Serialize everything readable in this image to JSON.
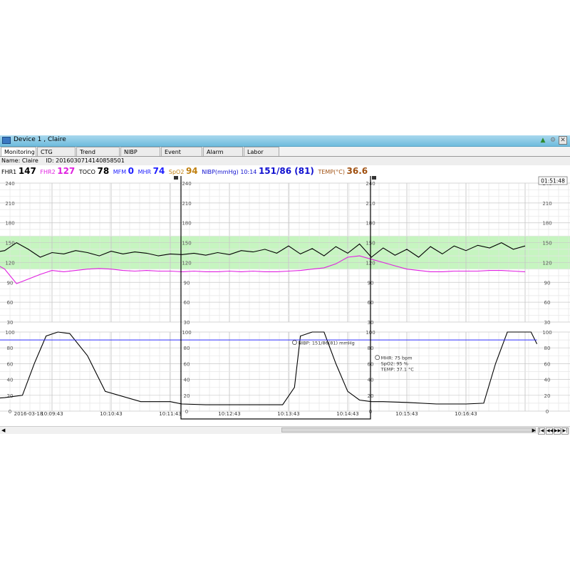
{
  "window": {
    "title": "Device 1 , Claire",
    "icons": [
      "monitor-icon",
      "bell-icon",
      "settings-icon",
      "close-icon"
    ]
  },
  "tabs": [
    {
      "label": "Monitoring",
      "active": true
    },
    {
      "label": "CTG Review",
      "active": false
    },
    {
      "label": "Trend Review",
      "active": false
    },
    {
      "label": "NIBP Review",
      "active": false
    },
    {
      "label": "Event Review",
      "active": false
    },
    {
      "label": "Alarm Setup",
      "active": false
    },
    {
      "label": "Labor Info.",
      "active": false
    }
  ],
  "patient": {
    "name_text": "Name: Claire",
    "id_text": "ID: 201603071414085850​1"
  },
  "vitals": {
    "fhr1_label": "FHR1",
    "fhr1_value": "147",
    "fhr2_label": "FHR2",
    "fhr2_value": "127",
    "toco_label": "TOCO",
    "toco_value": "78",
    "mfm_label": "MFM",
    "mfm_value": "0",
    "mhr_label": "MHR",
    "mhr_value": "74",
    "spo2_label": "SpO2",
    "spo2_value": "94",
    "nibp_label": "NIBP(mmHg) 10:14",
    "nibp_value": "151/86 (81)",
    "temp_label": "TEMP(°C)",
    "temp_value": "36.6"
  },
  "colors": {
    "fhr1": "#000000",
    "fhr2": "#e020e0",
    "toco": "#000000",
    "mfm": "#2020ff",
    "mhr": "#2020ff",
    "spo2": "#c08010",
    "nibp": "#1010d0",
    "temp": "#a05010",
    "normal_band": "#c6f5c0",
    "grid": "#c8c8c8",
    "maternal_trace": "#3030ff"
  },
  "clock": "01:51:48",
  "chart_data": {
    "type": "line",
    "fhr_axis": {
      "ticks": [
        30,
        60,
        90,
        120,
        150,
        180,
        210,
        240
      ],
      "ylim": [
        30,
        240
      ],
      "normal_band": [
        110,
        160
      ]
    },
    "uterine_axis": {
      "ticks": [
        0,
        20,
        40,
        60,
        80,
        100
      ],
      "ylim": [
        0,
        100
      ]
    },
    "time_labels": [
      "8:43",
      "2016-03-18",
      "10:09:43",
      "10:10:43",
      "10:11:43",
      "10:12:43",
      "10:13:43",
      "10:14:43",
      "10:15:43",
      "10:16:43"
    ],
    "time_label_minutes": [
      -1.0,
      null,
      0,
      1,
      2,
      3,
      4,
      5,
      6,
      7
    ],
    "x_range_minutes": [
      -1.2,
      8.5
    ],
    "series": [
      {
        "name": "FHR1",
        "x": [
          -1.2,
          -1.0,
          -0.8,
          -0.6,
          -0.4,
          -0.2,
          0,
          0.2,
          0.4,
          0.6,
          0.8,
          1.0,
          1.2,
          1.4,
          1.6,
          1.8,
          2.0,
          2.2,
          2.4,
          2.6,
          2.8,
          3.0,
          3.2,
          3.4,
          3.6,
          3.8,
          4.0,
          4.2,
          4.4,
          4.6,
          4.8,
          5.0,
          5.2,
          5.4,
          5.6,
          5.8,
          6.0,
          6.2,
          6.4,
          6.6,
          6.8,
          7.0,
          7.2,
          7.4,
          7.6,
          7.8,
          8.0
        ],
        "y": [
          130,
          135,
          138,
          150,
          140,
          128,
          135,
          133,
          138,
          135,
          130,
          137,
          133,
          136,
          134,
          130,
          133,
          132,
          134,
          131,
          135,
          132,
          138,
          136,
          140,
          134,
          145,
          133,
          141,
          130,
          144,
          134,
          148,
          128,
          142,
          131,
          140,
          128,
          144,
          133,
          145,
          138,
          146,
          142,
          150,
          140,
          145
        ]
      },
      {
        "name": "FHR2",
        "x": [
          -1.2,
          -1.0,
          -0.8,
          -0.6,
          -0.4,
          -0.2,
          0,
          0.2,
          0.4,
          0.6,
          0.8,
          1.0,
          1.2,
          1.4,
          1.6,
          1.8,
          2.0,
          2.2,
          2.4,
          2.6,
          2.8,
          3.0,
          3.2,
          3.4,
          3.6,
          3.8,
          4.0,
          4.2,
          4.4,
          4.6,
          4.8,
          5.0,
          5.2,
          5.4,
          5.6,
          5.8,
          6.0,
          6.2,
          6.4,
          6.6,
          6.8,
          7.0,
          7.2,
          7.4,
          7.6,
          7.8,
          8.0
        ],
        "y": [
          128,
          120,
          110,
          88,
          95,
          102,
          108,
          106,
          108,
          110,
          111,
          110,
          108,
          107,
          108,
          107,
          107,
          106,
          107,
          106,
          106,
          107,
          106,
          107,
          106,
          106,
          107,
          108,
          110,
          112,
          118,
          128,
          130,
          125,
          120,
          115,
          110,
          108,
          106,
          106,
          107,
          107,
          107,
          108,
          108,
          107,
          106
        ]
      },
      {
        "name": "TOCO",
        "x": [
          -1.2,
          -0.8,
          -0.5,
          -0.3,
          -0.1,
          0.1,
          0.3,
          0.6,
          0.9,
          1.5,
          2.0,
          2.2,
          2.6,
          3.0,
          3.5,
          3.9,
          4.1,
          4.2,
          4.4,
          4.6,
          4.8,
          5.0,
          5.2,
          5.4,
          5.6,
          6.0,
          6.5,
          7.0,
          7.3,
          7.5,
          7.7,
          7.9,
          8.1,
          8.2
        ],
        "y": [
          15,
          17,
          20,
          60,
          95,
          100,
          98,
          70,
          25,
          12,
          12,
          9,
          8,
          8,
          8,
          8,
          30,
          95,
          100,
          100,
          60,
          25,
          14,
          12,
          12,
          11,
          9,
          9,
          10,
          60,
          100,
          100,
          100,
          85
        ]
      },
      {
        "name": "MHR",
        "x": [
          -1.2,
          8.2
        ],
        "y": [
          90,
          90
        ]
      }
    ],
    "events": [
      {
        "text": "NIBP: 151/86(81) mmHg",
        "x_minute": 4.15,
        "y": 85
      },
      {
        "text": "MHR: 75 bpm",
        "x_minute": 5.55,
        "y": 66
      },
      {
        "text": "SpO2: 95 %",
        "x_minute": 5.55,
        "y": 59
      },
      {
        "text": "TEMP: 37.1 °C",
        "x_minute": 5.55,
        "y": 52
      }
    ]
  }
}
